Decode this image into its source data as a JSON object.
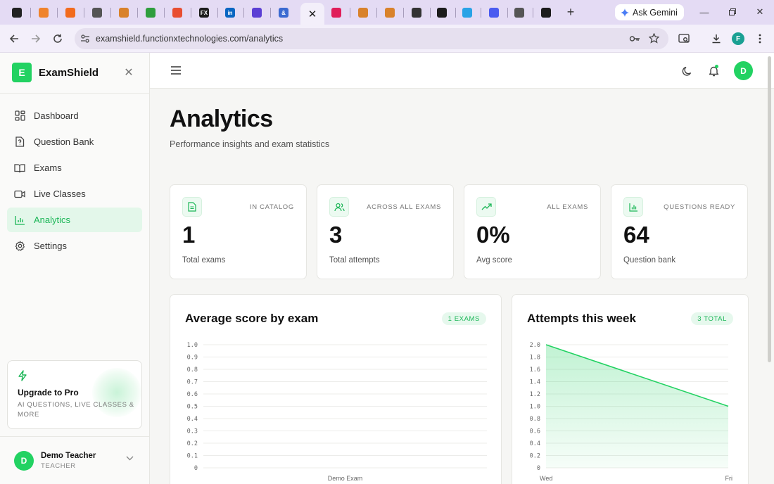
{
  "browser": {
    "ask_gemini": "Ask Gemini",
    "url": "examshield.functionxtechnologies.com/analytics",
    "profile_initial": "F",
    "favicons": [
      {
        "icon": "github-icon",
        "color": "#222222",
        "glyph": ""
      },
      {
        "icon": "orange-square-icon",
        "color": "#f0832b",
        "glyph": ""
      },
      {
        "icon": "cube-icon",
        "color": "#f26b1d",
        "glyph": ""
      },
      {
        "icon": "openai-icon",
        "color": "#555555",
        "glyph": ""
      },
      {
        "icon": "pva-icon",
        "color": "#d9822b",
        "glyph": ""
      },
      {
        "icon": "hexagon-icon",
        "color": "#2e9e3d",
        "glyph": ""
      },
      {
        "icon": "git-icon",
        "color": "#e84e31",
        "glyph": ""
      },
      {
        "icon": "fx-icon",
        "color": "#1c1c1c",
        "glyph": "FX"
      },
      {
        "icon": "linkedin-icon",
        "color": "#0a66c2",
        "glyph": "in"
      },
      {
        "icon": "mail-icon",
        "color": "#5b3fd4",
        "glyph": ""
      },
      {
        "icon": "ampersand-icon",
        "color": "#3b6ad1",
        "glyph": "&"
      },
      {
        "icon": "slack-icon",
        "color": "#e01e5a",
        "glyph": ""
      },
      {
        "icon": "pva-icon",
        "color": "#d9822b",
        "glyph": ""
      },
      {
        "icon": "pva-icon",
        "color": "#d9822b",
        "glyph": ""
      },
      {
        "icon": "graduation-cap-icon",
        "color": "#333333",
        "glyph": ""
      },
      {
        "icon": "puzzle-icon",
        "color": "#1c1c1c",
        "glyph": ""
      },
      {
        "icon": "bird-icon",
        "color": "#29a3e6",
        "glyph": ""
      },
      {
        "icon": "bolt-icon",
        "color": "#4a5bf0",
        "glyph": ""
      },
      {
        "icon": "globe-icon",
        "color": "#555555",
        "glyph": ""
      },
      {
        "icon": "puzzle-icon",
        "color": "#1c1c1c",
        "glyph": ""
      }
    ]
  },
  "sidebar": {
    "brand": "ExamShield",
    "brand_initial": "E",
    "items": [
      {
        "label": "Dashboard",
        "icon": "grid-icon"
      },
      {
        "label": "Question Bank",
        "icon": "file-question-icon"
      },
      {
        "label": "Exams",
        "icon": "book-icon"
      },
      {
        "label": "Live Classes",
        "icon": "video-icon"
      },
      {
        "label": "Analytics",
        "icon": "bar-chart-icon",
        "active": true
      },
      {
        "label": "Settings",
        "icon": "gear-icon"
      }
    ],
    "upgrade": {
      "title": "Upgrade to Pro",
      "subtitle": "AI QUESTIONS, LIVE CLASSES & MORE"
    },
    "user": {
      "initial": "D",
      "name": "Demo Teacher",
      "role": "TEACHER"
    }
  },
  "topbar": {
    "avatar_initial": "D"
  },
  "page": {
    "title": "Analytics",
    "subtitle": "Performance insights and exam statistics"
  },
  "stats": [
    {
      "tag": "IN CATALOG",
      "value": "1",
      "label": "Total exams",
      "icon": "document-icon"
    },
    {
      "tag": "ACROSS ALL EXAMS",
      "value": "3",
      "label": "Total attempts",
      "icon": "users-icon"
    },
    {
      "tag": "ALL EXAMS",
      "value": "0%",
      "label": "Avg score",
      "icon": "trending-up-icon"
    },
    {
      "tag": "QUESTIONS READY",
      "value": "64",
      "label": "Question bank",
      "icon": "bar-chart-icon"
    }
  ],
  "colors": {
    "accent": "#22d262",
    "accent_text": "#1ab656"
  },
  "chart_data": [
    {
      "type": "bar",
      "title": "Average score by exam",
      "badge": "1 EXAMS",
      "categories": [
        "Demo Exam"
      ],
      "values": [
        0
      ],
      "ylim": [
        0,
        1.0
      ],
      "yticks": [
        "0",
        "0.1",
        "0.2",
        "0.3",
        "0.4",
        "0.5",
        "0.6",
        "0.7",
        "0.8",
        "0.9",
        "1.0"
      ],
      "grid": true
    },
    {
      "type": "area",
      "title": "Attempts this week",
      "badge": "3 TOTAL",
      "x": [
        "Wed",
        "Fri"
      ],
      "values": [
        2,
        1
      ],
      "ylim": [
        0,
        2.0
      ],
      "yticks": [
        "0",
        "0.2",
        "0.4",
        "0.6",
        "0.8",
        "1.0",
        "1.2",
        "1.4",
        "1.6",
        "1.8",
        "2.0"
      ],
      "grid": true
    }
  ]
}
